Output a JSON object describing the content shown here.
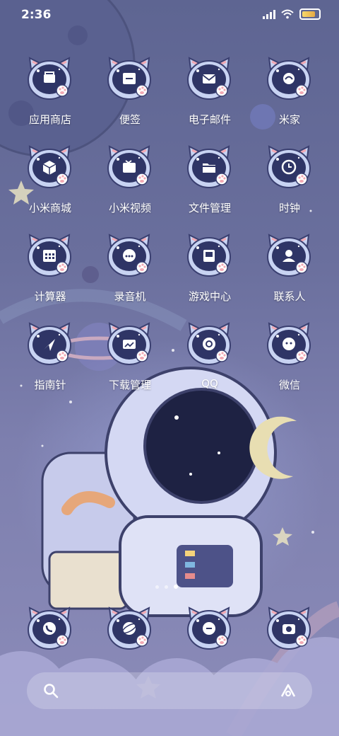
{
  "status_bar": {
    "time": "2:36"
  },
  "apps": [
    {
      "label": "应用商店",
      "icon": "store-icon"
    },
    {
      "label": "便签",
      "icon": "notes-icon"
    },
    {
      "label": "电子邮件",
      "icon": "mail-icon"
    },
    {
      "label": "米家",
      "icon": "mihome-icon"
    },
    {
      "label": "小米商城",
      "icon": "shop-icon"
    },
    {
      "label": "小米视频",
      "icon": "video-icon"
    },
    {
      "label": "文件管理",
      "icon": "folder-icon"
    },
    {
      "label": "时钟",
      "icon": "clock-icon"
    },
    {
      "label": "计算器",
      "icon": "calculator-icon"
    },
    {
      "label": "录音机",
      "icon": "recorder-icon"
    },
    {
      "label": "游戏中心",
      "icon": "game-icon"
    },
    {
      "label": "联系人",
      "icon": "contacts-icon"
    },
    {
      "label": "指南针",
      "icon": "compass-icon"
    },
    {
      "label": "下载管理",
      "icon": "download-icon"
    },
    {
      "label": "QQ",
      "icon": "qq-icon"
    },
    {
      "label": "微信",
      "icon": "wechat-icon"
    }
  ],
  "dock": [
    {
      "icon": "phone-icon"
    },
    {
      "icon": "browser-icon"
    },
    {
      "icon": "messages-icon"
    },
    {
      "icon": "camera-icon"
    }
  ],
  "pager": {
    "pages": 3,
    "current": 3
  },
  "colors": {
    "accent": "#f6d96b",
    "icon_face": "#2f3566",
    "icon_rim": "#c8d3f2"
  }
}
